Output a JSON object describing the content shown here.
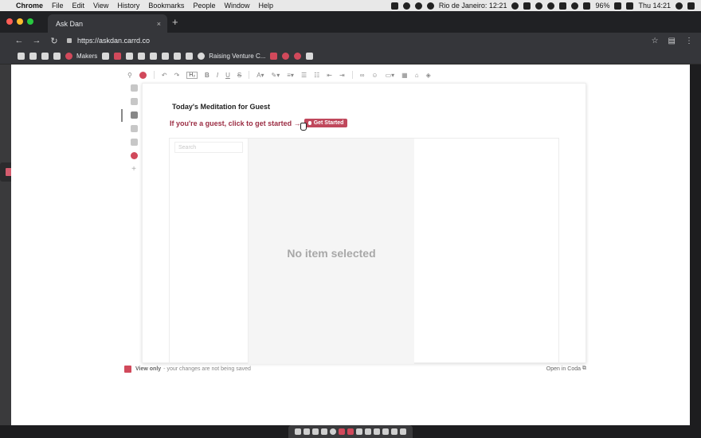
{
  "menubar": {
    "app": "Chrome",
    "items": [
      "File",
      "Edit",
      "View",
      "History",
      "Bookmarks",
      "People",
      "Window",
      "Help"
    ],
    "clock_location": "Rio de Janeiro: 12:21",
    "battery": "96%",
    "time": "Thu 14:21"
  },
  "browser": {
    "tab_title": "Ask Dan",
    "tab_close": "×",
    "new_tab": "+",
    "url": "https://askdan.carrd.co",
    "back": "←",
    "forward": "→",
    "reload": "↻",
    "star": "☆"
  },
  "bookmarks": [
    {
      "label": "Makers",
      "icon": "makers-icon"
    },
    {
      "label": "Raising Venture C...",
      "icon": "globe-icon"
    }
  ],
  "doc": {
    "title": "Today's Meditation for  Guest",
    "guest_prompt": "If you're a guest, click to get started →",
    "get_started": "Get Started",
    "search_placeholder": "Search",
    "empty_state": "No item selected"
  },
  "footer": {
    "view_only": "View only",
    "note": "- your changes are not being saved",
    "open_in_coda": "Open in Coda"
  },
  "colors": {
    "accent": "#c0485c",
    "accent_text": "#9b2d43"
  }
}
